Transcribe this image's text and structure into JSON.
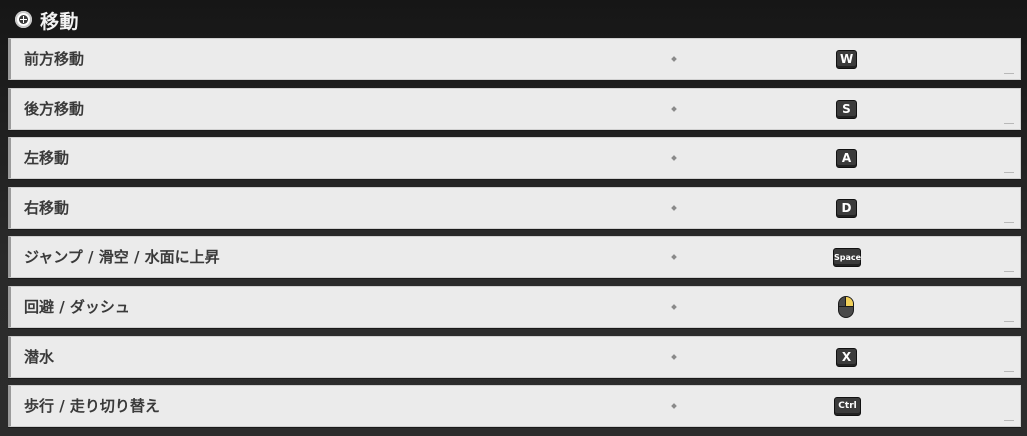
{
  "section": {
    "title": "移動",
    "icon": "plus-circle-icon"
  },
  "rows": [
    {
      "label": "前方移動",
      "key": "W"
    },
    {
      "label": "後方移動",
      "key": "S"
    },
    {
      "label": "左移動",
      "key": "A"
    },
    {
      "label": "右移動",
      "key": "D"
    },
    {
      "label": "ジャンプ / 滑空 / 水面に上昇",
      "key": "Space"
    },
    {
      "label": "回避 / ダッシュ",
      "key_icon": "mouse-right-button-icon"
    },
    {
      "label": "潜水",
      "key": "X"
    },
    {
      "label": "歩行 / 走り切り替え",
      "key": "Ctrl"
    }
  ],
  "colors": {
    "row_background": "#ebebeb",
    "key_background": "#3b3b3b",
    "mouse_highlight": "#f2d15a"
  }
}
